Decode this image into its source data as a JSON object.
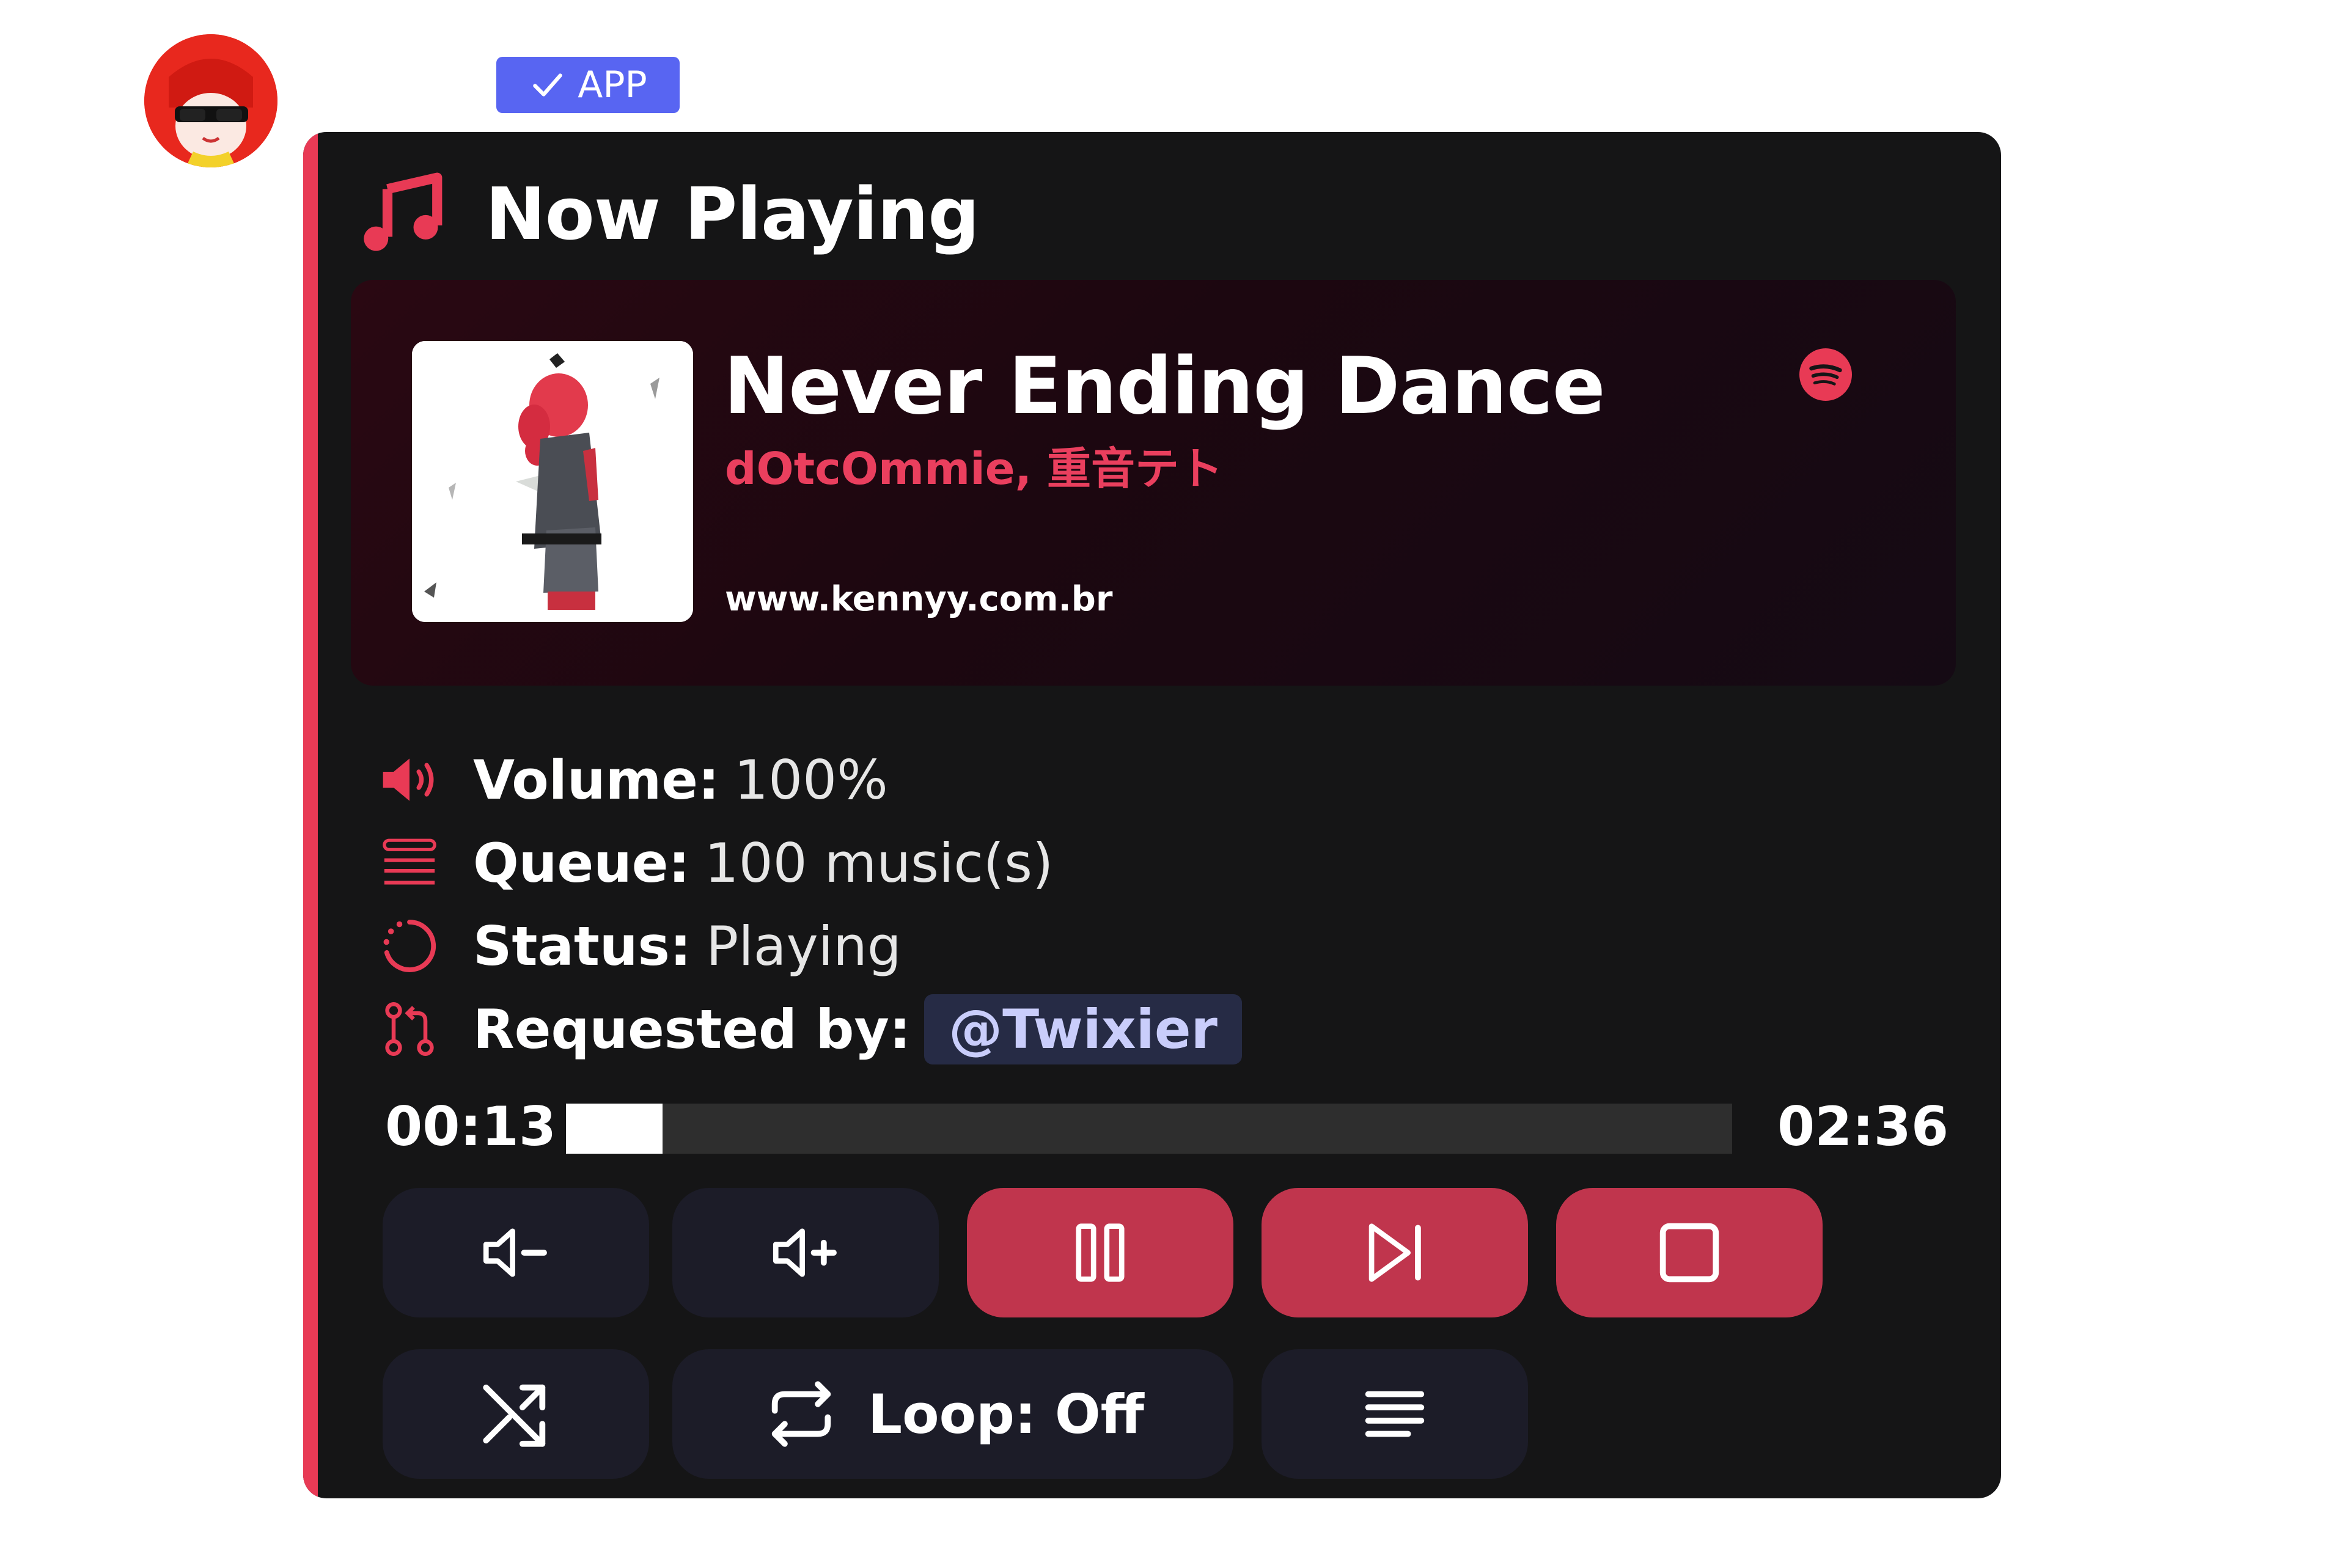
{
  "badge": {
    "label": "APP"
  },
  "header": {
    "title": "Now Playing"
  },
  "track": {
    "title": "Never Ending Dance",
    "artist": "dOtcOmmie, 重音テト",
    "website": "www.kennyy.com.br",
    "service_icon": "spotify-icon"
  },
  "info": {
    "volume": {
      "label": "Volume:",
      "value": "100%"
    },
    "queue": {
      "label": "Queue:",
      "value": "100 music(s)"
    },
    "status": {
      "label": "Status:",
      "value": "Playing"
    },
    "requested": {
      "label": "Requested by:",
      "value": "@Twixier"
    }
  },
  "progress": {
    "elapsed": "00:13",
    "total": "02:36",
    "fraction": 0.083
  },
  "controls": {
    "volume_down_icon": "volume-down-icon",
    "volume_up_icon": "volume-up-icon",
    "pause_icon": "pause-icon",
    "skip_icon": "skip-next-icon",
    "stop_icon": "stop-icon",
    "shuffle_icon": "shuffle-icon",
    "loop_label": "Loop: Off",
    "queue_icon": "queue-list-icon"
  },
  "colors": {
    "accent": "#e83a55",
    "button_red": "#c0354d",
    "button_dark": "#1c1c28",
    "card_bg": "#151516",
    "badge_bg": "#5865f2",
    "mention_bg": "#262b45",
    "mention_text": "#c9cdfb"
  }
}
